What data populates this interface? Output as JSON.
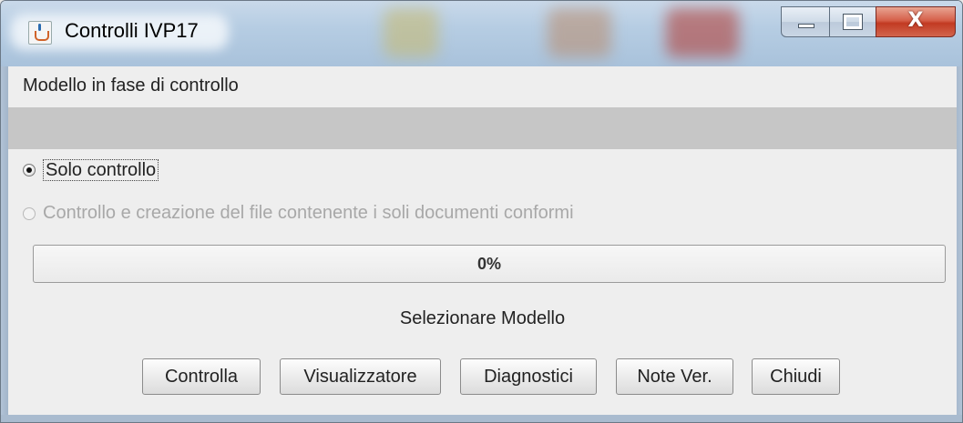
{
  "window": {
    "title": "Controlli IVP17",
    "icon": "java-icon",
    "controls": {
      "minimize_icon": "minimize-icon",
      "maximize_icon": "maximize-icon",
      "close_glyph": "X"
    }
  },
  "model": {
    "label": "Modello in fase di controllo",
    "value": ""
  },
  "options": [
    {
      "label": "Solo controllo",
      "checked": true,
      "enabled": true
    },
    {
      "label": "Controllo e creazione del file contenente i soli documenti conformi",
      "checked": false,
      "enabled": false
    }
  ],
  "progress": {
    "value": 0,
    "text": "0%"
  },
  "status": "Selezionare Modello",
  "buttons": {
    "controlla": "Controlla",
    "visualizzatore": "Visualizzatore",
    "diagnostici": "Diagnostici",
    "note_ver": "Note Ver.",
    "chiudi": "Chiudi"
  },
  "colors": {
    "titlebar": "#b6cde3",
    "close_button": "#c23a22",
    "model_value_bg": "#c6c6c6",
    "window_bg": "#eeeeee"
  }
}
